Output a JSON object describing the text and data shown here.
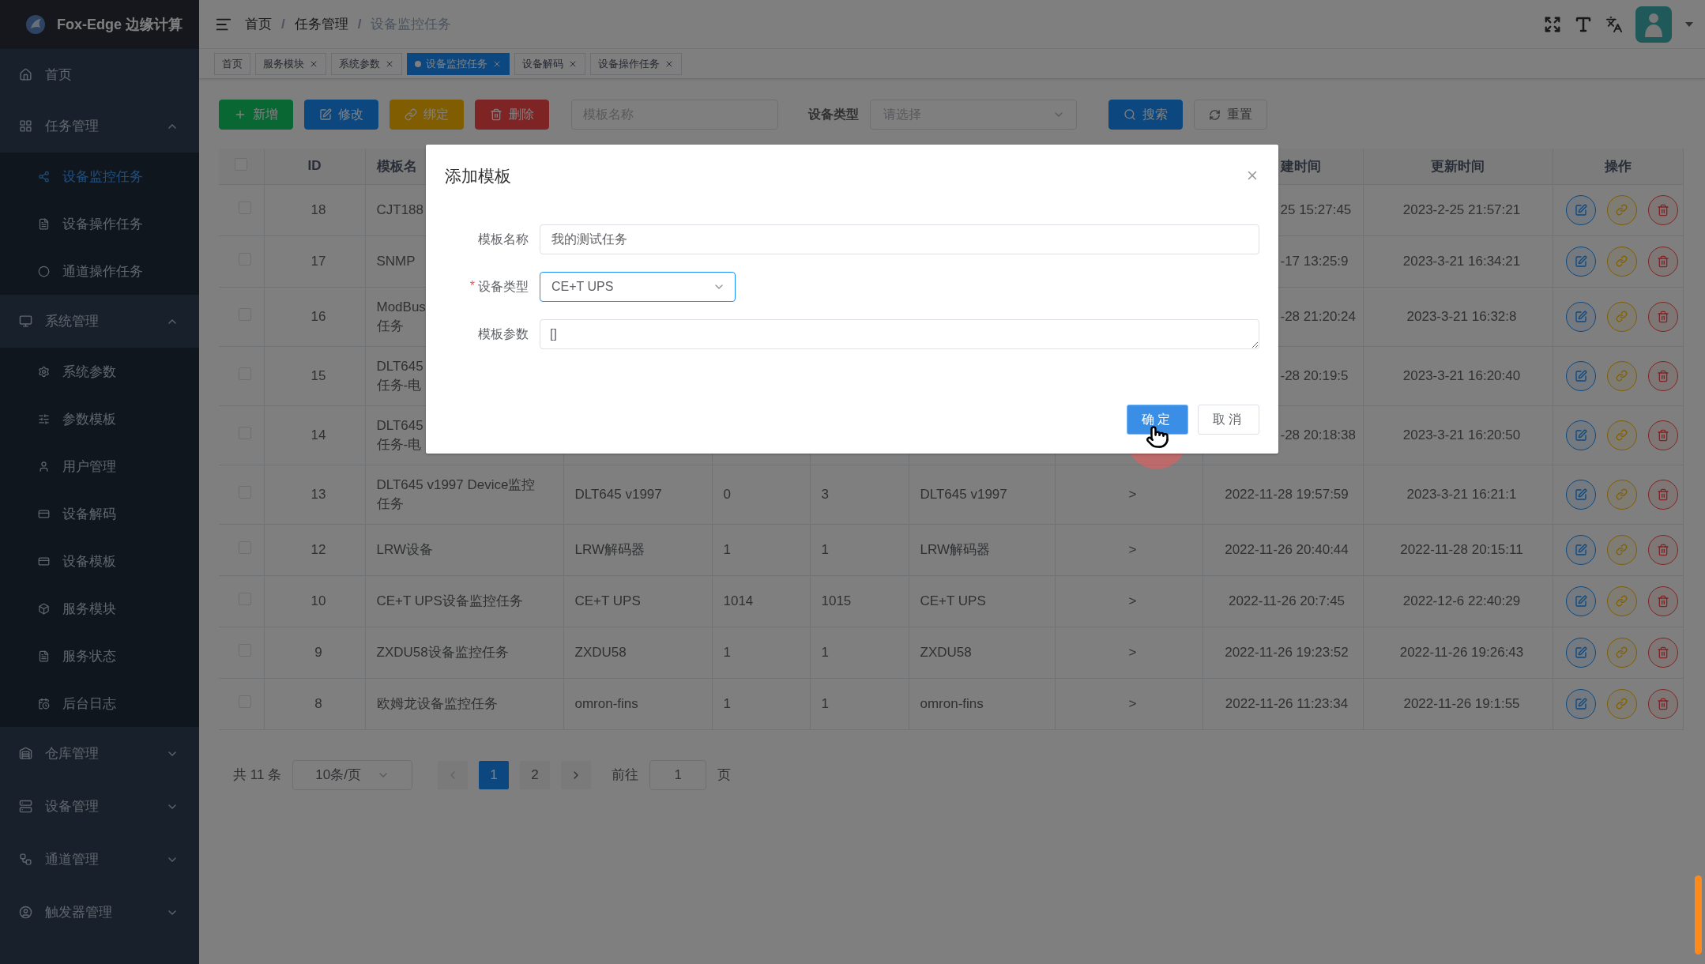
{
  "app": {
    "title": "Fox-Edge 边缘计算"
  },
  "sidebar": {
    "items": [
      {
        "label": "首页",
        "selected": false
      },
      {
        "label": "任务管理",
        "selected": false,
        "expanded": true,
        "children": [
          {
            "label": "设备监控任务",
            "selected": true
          },
          {
            "label": "设备操作任务",
            "selected": false
          },
          {
            "label": "通道操作任务",
            "selected": false
          }
        ]
      },
      {
        "label": "系统管理",
        "selected": false,
        "expanded": true,
        "children": [
          {
            "label": "系统参数",
            "selected": false
          },
          {
            "label": "参数模板",
            "selected": false
          },
          {
            "label": "用户管理",
            "selected": false
          },
          {
            "label": "设备解码",
            "selected": false
          },
          {
            "label": "设备模板",
            "selected": false
          },
          {
            "label": "服务模块",
            "selected": false
          },
          {
            "label": "服务状态",
            "selected": false
          },
          {
            "label": "后台日志",
            "selected": false
          }
        ]
      },
      {
        "label": "仓库管理",
        "selected": false,
        "expanded": false
      },
      {
        "label": "设备管理",
        "selected": false,
        "expanded": false
      },
      {
        "label": "通道管理",
        "selected": false,
        "expanded": false
      },
      {
        "label": "触发器管理",
        "selected": false,
        "expanded": false
      }
    ]
  },
  "breadcrumb": [
    {
      "label": "首页",
      "current": false
    },
    {
      "separator": "/",
      "label": "任务管理",
      "current": false
    },
    {
      "separator": "/",
      "label": "设备监控任务",
      "current": true
    }
  ],
  "tabs": [
    {
      "label": "首页",
      "selected": false,
      "closable": false
    },
    {
      "label": "服务模块",
      "selected": false,
      "closable": true
    },
    {
      "label": "系统参数",
      "selected": false,
      "closable": true
    },
    {
      "label": "设备监控任务",
      "selected": true,
      "closable": true
    },
    {
      "label": "设备解码",
      "selected": false,
      "closable": true
    },
    {
      "label": "设备操作任务",
      "selected": false,
      "closable": true
    }
  ],
  "toolbar": {
    "buttons": [
      {
        "kind": "success",
        "label": "新增"
      },
      {
        "kind": "primary",
        "label": "修改"
      },
      {
        "kind": "warning",
        "label": "绑定"
      },
      {
        "kind": "danger",
        "label": "删除"
      }
    ],
    "name_filter": {
      "placeholder": "模板名称"
    },
    "type_filter": {
      "label": "设备类型",
      "placeholder": "请选择"
    },
    "search_button": {
      "label": "搜索"
    },
    "reset_button": {
      "label": "重置"
    }
  },
  "table": {
    "header": {
      "checked": false,
      "under_dialog": true,
      "columns": [
        "ID",
        "模板名",
        null,
        null,
        null,
        null,
        null,
        "建时间",
        "更新时间",
        "操作"
      ]
    },
    "rows": [
      {
        "checked": false,
        "under_dialog": true,
        "cells": [
          "18",
          [
            "CJT188"
          ],
          null,
          null,
          null,
          null,
          null,
          "25 15:27:45",
          "2023-2-25 21:57:21"
        ]
      },
      {
        "checked": false,
        "under_dialog": true,
        "cells": [
          "17",
          [
            "SNMP"
          ],
          null,
          null,
          null,
          null,
          null,
          "-17 13:25:9",
          "2023-3-21 16:34:21"
        ]
      },
      {
        "checked": false,
        "under_dialog": true,
        "cells": [
          "16",
          [
            "ModBus",
            "任务"
          ],
          null,
          null,
          null,
          null,
          null,
          "-28 21:20:24",
          "2023-3-21 16:32:8"
        ]
      },
      {
        "checked": false,
        "under_dialog": true,
        "cells": [
          "15",
          [
            "DLT645",
            "任务-电"
          ],
          null,
          null,
          null,
          null,
          null,
          "-28 20:19:5",
          "2023-3-21 16:20:40"
        ]
      },
      {
        "checked": false,
        "under_dialog": true,
        "cells": [
          "14",
          [
            "DLT645",
            "任务-电"
          ],
          null,
          null,
          null,
          null,
          null,
          "-28 20:18:38",
          "2023-3-21 16:20:50"
        ]
      },
      {
        "checked": false,
        "under_dialog": false,
        "cells": [
          "13",
          [
            "DLT645 v1997 Device监控",
            "任务"
          ],
          "DLT645 v1997",
          "0",
          "3",
          "DLT645 v1997",
          ">",
          "2022-11-28 19:57:59",
          "2023-3-21 16:21:1"
        ]
      },
      {
        "checked": false,
        "under_dialog": false,
        "cells": [
          "12",
          "LRW设备",
          "LRW解码器",
          "1",
          "1",
          "LRW解码器",
          ">",
          "2022-11-26 20:40:44",
          "2022-11-28 20:15:11"
        ]
      },
      {
        "checked": false,
        "under_dialog": false,
        "cells": [
          "10",
          "CE+T UPS设备监控任务",
          "CE+T UPS",
          "1014",
          "1015",
          "CE+T UPS",
          ">",
          "2022-11-26 20:7:45",
          "2022-12-6 22:40:29"
        ]
      },
      {
        "checked": false,
        "under_dialog": false,
        "cells": [
          "9",
          "ZXDU58设备监控任务",
          "ZXDU58",
          "1",
          "1",
          "ZXDU58",
          ">",
          "2022-11-26 19:23:52",
          "2022-11-26 19:26:43"
        ]
      },
      {
        "checked": false,
        "under_dialog": false,
        "cells": [
          "8",
          "欧姆龙设备监控任务",
          "omron-fins",
          "1",
          "1",
          "omron-fins",
          ">",
          "2022-11-26 11:23:34",
          "2022-11-26 19:1:55"
        ]
      }
    ]
  },
  "pagination": {
    "total": "共 11 条",
    "page_size": "10条/页",
    "pages": [
      {
        "label": "1",
        "selected": true
      },
      {
        "label": "2",
        "selected": false
      }
    ],
    "goto_label": "前往",
    "goto_value": "1",
    "page_suffix": "页"
  },
  "dialog": {
    "title": "添加模板",
    "fields": [
      {
        "kind": "input",
        "label": "模板名称",
        "value": "我的测试任务"
      },
      {
        "kind": "select",
        "label": "设备类型",
        "required_mark": "*",
        "value": "CE+T UPS"
      },
      {
        "kind": "textarea",
        "label": "模板参数",
        "value": "[]"
      }
    ],
    "confirm": {
      "label": "确定"
    },
    "cancel": {
      "label": "取消"
    }
  }
}
